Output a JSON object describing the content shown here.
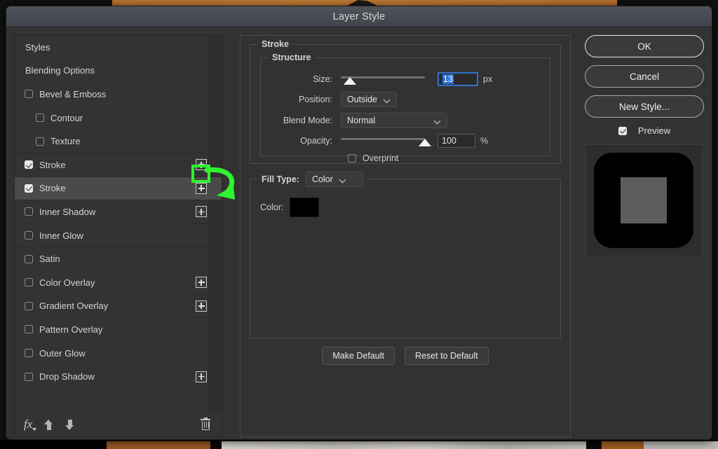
{
  "window": {
    "title": "Layer Style"
  },
  "styles_panel": {
    "items": [
      {
        "label": "Styles",
        "type": "header",
        "checked": null,
        "indent": false,
        "plus": false,
        "selected": false
      },
      {
        "label": "Blending Options",
        "type": "header",
        "checked": null,
        "indent": false,
        "plus": false,
        "selected": false
      },
      {
        "label": "Bevel & Emboss",
        "type": "effect",
        "checked": false,
        "indent": false,
        "plus": false,
        "selected": false
      },
      {
        "label": "Contour",
        "type": "effect",
        "checked": false,
        "indent": true,
        "plus": false,
        "selected": false
      },
      {
        "label": "Texture",
        "type": "effect",
        "checked": false,
        "indent": true,
        "plus": false,
        "selected": false
      },
      {
        "label": "Stroke",
        "type": "effect",
        "checked": true,
        "indent": false,
        "plus": true,
        "selected": false
      },
      {
        "label": "Stroke",
        "type": "effect",
        "checked": true,
        "indent": false,
        "plus": true,
        "selected": true
      },
      {
        "label": "Inner Shadow",
        "type": "effect",
        "checked": false,
        "indent": false,
        "plus": true,
        "selected": false
      },
      {
        "label": "Inner Glow",
        "type": "effect",
        "checked": false,
        "indent": false,
        "plus": false,
        "selected": false
      },
      {
        "label": "Satin",
        "type": "effect",
        "checked": false,
        "indent": false,
        "plus": false,
        "selected": false
      },
      {
        "label": "Color Overlay",
        "type": "effect",
        "checked": false,
        "indent": false,
        "plus": true,
        "selected": false
      },
      {
        "label": "Gradient Overlay",
        "type": "effect",
        "checked": false,
        "indent": false,
        "plus": true,
        "selected": false
      },
      {
        "label": "Pattern Overlay",
        "type": "effect",
        "checked": false,
        "indent": false,
        "plus": false,
        "selected": false
      },
      {
        "label": "Outer Glow",
        "type": "effect",
        "checked": false,
        "indent": false,
        "plus": false,
        "selected": false
      },
      {
        "label": "Drop Shadow",
        "type": "effect",
        "checked": false,
        "indent": false,
        "plus": true,
        "selected": false
      }
    ],
    "toolbar": {
      "fx_icon": "fx-icon",
      "move_up_icon": "arrow-up-icon",
      "move_down_icon": "arrow-down-icon",
      "delete_icon": "trash-icon"
    }
  },
  "settings": {
    "section_title": "Stroke",
    "structure": {
      "legend": "Structure",
      "size": {
        "label": "Size:",
        "value": "13",
        "unit": "px",
        "slider_percent": 11
      },
      "position": {
        "label": "Position:",
        "value": "Outside"
      },
      "blend_mode": {
        "label": "Blend Mode:",
        "value": "Normal"
      },
      "opacity": {
        "label": "Opacity:",
        "value": "100",
        "unit": "%",
        "slider_percent": 100
      },
      "overprint": {
        "label": "Overprint",
        "checked": false
      }
    },
    "fill": {
      "legend": "Fill Type:",
      "fill_type_value": "Color",
      "color_label": "Color:",
      "color_value": "#000000"
    },
    "make_default_label": "Make Default",
    "reset_default_label": "Reset to Default"
  },
  "actions": {
    "ok": "OK",
    "cancel": "Cancel",
    "new_style": "New Style...",
    "preview_label": "Preview",
    "preview_checked": true
  },
  "annotation": {
    "highlight_color": "#2ef32e",
    "highlight_target": "add-stroke-plus-button",
    "arrow_target": "duplicated-stroke-plus-button"
  }
}
